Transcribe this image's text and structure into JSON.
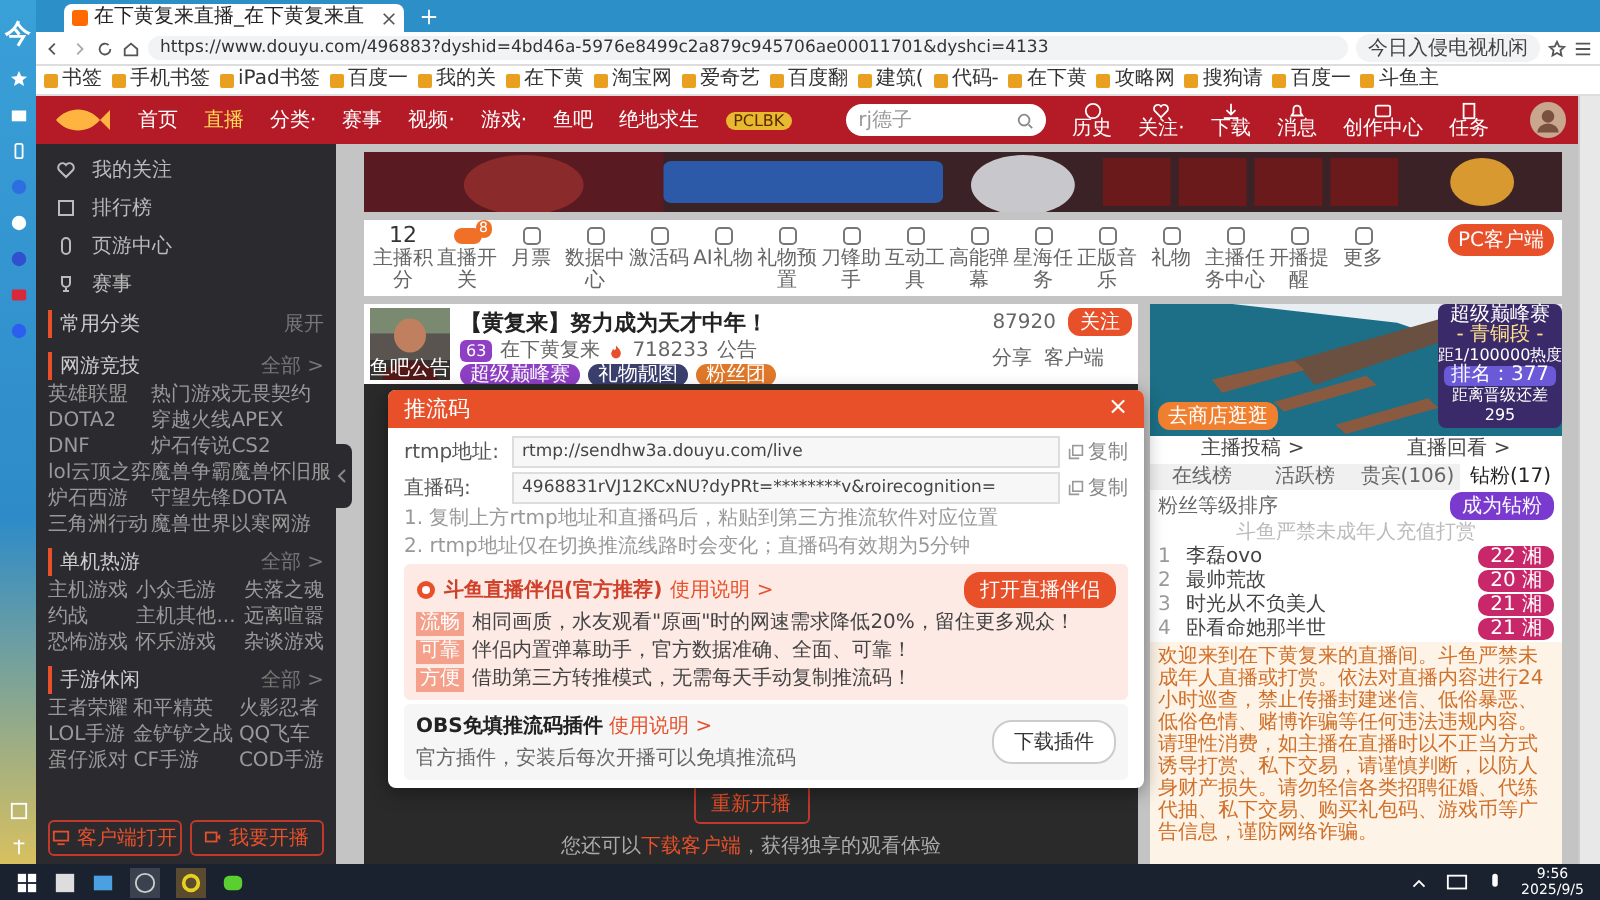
{
  "launcher_glyph": "今",
  "browser": {
    "tab_title": "在下黄复来直播_在下黄复来直",
    "url": "https://www.douyu.com/496883?dyshid=4bd46a-5976e8499c2a879c945706ae00011701&dyshci=4133",
    "address_hint": "今日入侵电视机闲",
    "bookmarks": [
      "书签",
      "手机书签",
      "iPad书签",
      "百度一",
      "我的关",
      "在下黄",
      "淘宝网",
      "爱奇艺",
      "百度翻",
      "建筑(",
      "代码-",
      "在下黄",
      "攻略网",
      "搜狗请",
      "百度一",
      "斗鱼主"
    ]
  },
  "header": {
    "nav": [
      {
        "label": "首页",
        "selected": false
      },
      {
        "label": "直播",
        "selected": true
      },
      {
        "label": "分类·",
        "selected": false
      },
      {
        "label": "赛事",
        "selected": false
      },
      {
        "label": "视频·",
        "selected": false
      },
      {
        "label": "游戏·",
        "selected": false
      },
      {
        "label": "鱼吧",
        "selected": false
      },
      {
        "label": "绝地求生",
        "selected": false
      }
    ],
    "event_label": "PCLBK",
    "search_placeholder": "rj德子",
    "actions": [
      {
        "kind": "clock",
        "label": "历史"
      },
      {
        "kind": "heart",
        "label": "关注·"
      },
      {
        "kind": "download",
        "label": "下载"
      },
      {
        "kind": "bell",
        "label": "消息"
      },
      {
        "kind": "creator",
        "label": "创作中心"
      },
      {
        "kind": "task",
        "label": "任务"
      }
    ]
  },
  "sidebar": {
    "nav": [
      {
        "kind": "heart",
        "label": "我的关注"
      },
      {
        "kind": "rank",
        "label": "排行榜"
      },
      {
        "kind": "mouse",
        "label": "页游中心"
      },
      {
        "kind": "trophy",
        "label": "赛事"
      }
    ],
    "sections": [
      {
        "title": "常用分类",
        "more": "展开"
      },
      {
        "title": "网游竞技",
        "more": "全部 >",
        "items": [
          "英雄联盟",
          "热门游戏",
          "无畏契约",
          "DOTA2",
          "穿越火线",
          "APEX",
          "DNF",
          "炉石传说",
          "CS2",
          "lol云顶之弈",
          "魔兽争霸",
          "魔兽怀旧服",
          "炉石西游",
          "守望先锋",
          "DOTA",
          "三角洲行动",
          "魔兽世界",
          "以寒网游"
        ]
      },
      {
        "title": "单机热游",
        "more": "全部 >",
        "items": [
          "主机游戏",
          "小众毛游",
          "失落之魂",
          "约战",
          "主机其他...",
          "远离喧嚣",
          "恐怖游戏",
          "怀乐游戏",
          "杂谈游戏"
        ]
      },
      {
        "title": "手游休闲",
        "more": "全部 >",
        "items": [
          "王者荣耀",
          "和平精英",
          "火影忍者",
          "LOL手游",
          "金铲铲之战",
          "QQ飞车",
          "蛋仔派对",
          "CF手游",
          "COD手游"
        ]
      }
    ],
    "buttons": [
      {
        "kind": "client",
        "label": "客户端打开"
      },
      {
        "kind": "live",
        "label": "我要开播"
      }
    ]
  },
  "toolbar": [
    {
      "kind": "count",
      "value": "12",
      "label": "主播积分"
    },
    {
      "kind": "toggle",
      "label": "直播开关",
      "badge": "8"
    },
    {
      "kind": "icon",
      "label": "月票"
    },
    {
      "kind": "icon",
      "label": "数据中心"
    },
    {
      "kind": "icon",
      "label": "激活码"
    },
    {
      "kind": "icon",
      "label": "AI礼物"
    },
    {
      "kind": "icon",
      "label": "礼物预置"
    },
    {
      "kind": "icon",
      "label": "刀锋助手"
    },
    {
      "kind": "icon",
      "label": "互动工具"
    },
    {
      "kind": "icon",
      "label": "高能弹幕"
    },
    {
      "kind": "icon",
      "label": "星海任务"
    },
    {
      "kind": "icon",
      "label": "正版音乐"
    },
    {
      "kind": "icon",
      "label": "礼物"
    },
    {
      "kind": "icon",
      "label": "主播任务中心"
    },
    {
      "kind": "icon",
      "label": "开播提醒"
    },
    {
      "kind": "icon",
      "label": "更多"
    }
  ],
  "pc_client": "PC客户端",
  "streamer": {
    "avatar_labels": [
      "鱼吧",
      "公告"
    ],
    "title": "【黄复来】努力成为天才中年！",
    "level": "63",
    "name": "在下黄复来",
    "heat": "718233",
    "notice": "公告",
    "tags": [
      {
        "label": "超级巅峰赛",
        "color": "#8e3fc4"
      },
      {
        "label": "礼物靓图",
        "color": "#3a3f6e"
      },
      {
        "label": "粉丝团",
        "color": "#e0782a"
      }
    ],
    "followers": "87920",
    "follow": "关注",
    "share": "分享",
    "client": "客户端"
  },
  "video": {
    "restart": "重新开播",
    "hint_before": "您还可以",
    "hint_link": "下载客户端",
    "hint_after": "，获得独享的观看体验"
  },
  "right": {
    "store_button": "去商店逛逛",
    "widget": {
      "title": "超级巅峰赛",
      "tier": "- 青铜段 -",
      "hint": "距1/100000热度",
      "rank": "排名：377",
      "gap_label": "距离晋级还差",
      "gap": "295"
    },
    "links": [
      "主播投稿 >",
      "直播回看 >"
    ],
    "tabs": [
      {
        "label": "在线榜",
        "selected": false
      },
      {
        "label": "活跃榜",
        "selected": false
      },
      {
        "label": "贵宾(106)",
        "selected": false
      },
      {
        "label": "钻粉(17)",
        "selected": true
      }
    ],
    "sort_label": "粉丝等级排序",
    "join_button": "成为钻粉",
    "minor_notice": "斗鱼严禁未成年人充值打赏",
    "fans": [
      {
        "rank": "1",
        "name": "李磊ovo",
        "level": "22",
        "club": "湘"
      },
      {
        "rank": "2",
        "name": "最帅荒故",
        "level": "20",
        "club": "湘"
      },
      {
        "rank": "3",
        "name": "时光从不负美人",
        "level": "21",
        "club": "湘"
      },
      {
        "rank": "4",
        "name": "卧看命她那半世",
        "level": "21",
        "club": "湘"
      }
    ],
    "notice": "欢迎来到在下黄复来的直播间。斗鱼严禁未成年人直播或打赏。依法对直播内容进行24小时巡查，禁止传播封建迷信、低俗暴恶、低俗色情、赌博诈骗等任何违法违规内容。请理性消费，如主播在直播时以不正当方式诱导打赏、私下交易，请谨慎判断，以防人身财产损失。请勿轻信各类招聘征婚、代练代抽、私下交易、购买礼包码、游戏币等广告信息，谨防网络诈骗。"
  },
  "modal": {
    "title": "推流码",
    "close": "×",
    "fields": [
      {
        "label": "rtmp地址:",
        "value": "rtmp://sendhw3a.douyu.com/live",
        "copy": "复制"
      },
      {
        "label": "直播码:",
        "value": "4968831rVJ12KCxNU?dyPRt=********v&roirecognition=",
        "copy": "复制"
      }
    ],
    "notes": [
      "1. 复制上方rtmp地址和直播码后，粘贴到第三方推流软件对应位置",
      "2. rtmp地址仅在切换推流线路时会变化；直播码有效期为5分钟"
    ],
    "promo": {
      "title": "斗鱼直播伴侣(官方推荐)",
      "guide": "使用说明 >",
      "button": "打开直播伴侣",
      "points": [
        {
          "tag": "流畅",
          "text": "相同画质，水友观看\"原画\"时的网速需求降低20%，留住更多观众！"
        },
        {
          "tag": "可靠",
          "text": "伴侣内置弹幕助手，官方数据准确、全面、可靠！"
        },
        {
          "tag": "方便",
          "text": "借助第三方转推模式，无需每天手动复制推流码！"
        }
      ]
    },
    "obs": {
      "title": "OBS免填推流码插件",
      "guide": "使用说明 >",
      "text": "官方插件，安装后每次开播可以免填推流码",
      "button": "下载插件"
    }
  },
  "taskbar": {
    "time": "9:56",
    "date": "2025/9/5"
  }
}
